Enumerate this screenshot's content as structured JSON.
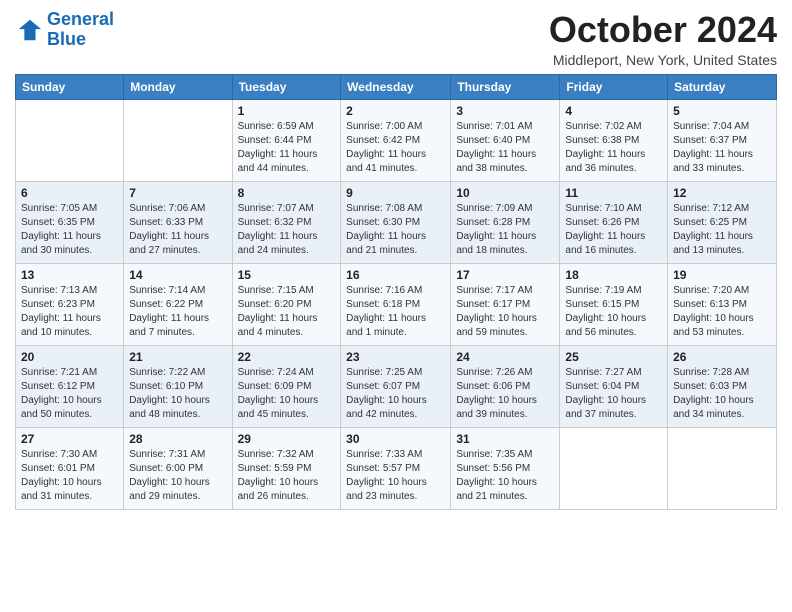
{
  "logo": {
    "line1": "General",
    "line2": "Blue"
  },
  "title": "October 2024",
  "subtitle": "Middleport, New York, United States",
  "days_of_week": [
    "Sunday",
    "Monday",
    "Tuesday",
    "Wednesday",
    "Thursday",
    "Friday",
    "Saturday"
  ],
  "weeks": [
    [
      {
        "day": "",
        "detail": ""
      },
      {
        "day": "",
        "detail": ""
      },
      {
        "day": "1",
        "detail": "Sunrise: 6:59 AM\nSunset: 6:44 PM\nDaylight: 11 hours and 44 minutes."
      },
      {
        "day": "2",
        "detail": "Sunrise: 7:00 AM\nSunset: 6:42 PM\nDaylight: 11 hours and 41 minutes."
      },
      {
        "day": "3",
        "detail": "Sunrise: 7:01 AM\nSunset: 6:40 PM\nDaylight: 11 hours and 38 minutes."
      },
      {
        "day": "4",
        "detail": "Sunrise: 7:02 AM\nSunset: 6:38 PM\nDaylight: 11 hours and 36 minutes."
      },
      {
        "day": "5",
        "detail": "Sunrise: 7:04 AM\nSunset: 6:37 PM\nDaylight: 11 hours and 33 minutes."
      }
    ],
    [
      {
        "day": "6",
        "detail": "Sunrise: 7:05 AM\nSunset: 6:35 PM\nDaylight: 11 hours and 30 minutes."
      },
      {
        "day": "7",
        "detail": "Sunrise: 7:06 AM\nSunset: 6:33 PM\nDaylight: 11 hours and 27 minutes."
      },
      {
        "day": "8",
        "detail": "Sunrise: 7:07 AM\nSunset: 6:32 PM\nDaylight: 11 hours and 24 minutes."
      },
      {
        "day": "9",
        "detail": "Sunrise: 7:08 AM\nSunset: 6:30 PM\nDaylight: 11 hours and 21 minutes."
      },
      {
        "day": "10",
        "detail": "Sunrise: 7:09 AM\nSunset: 6:28 PM\nDaylight: 11 hours and 18 minutes."
      },
      {
        "day": "11",
        "detail": "Sunrise: 7:10 AM\nSunset: 6:26 PM\nDaylight: 11 hours and 16 minutes."
      },
      {
        "day": "12",
        "detail": "Sunrise: 7:12 AM\nSunset: 6:25 PM\nDaylight: 11 hours and 13 minutes."
      }
    ],
    [
      {
        "day": "13",
        "detail": "Sunrise: 7:13 AM\nSunset: 6:23 PM\nDaylight: 11 hours and 10 minutes."
      },
      {
        "day": "14",
        "detail": "Sunrise: 7:14 AM\nSunset: 6:22 PM\nDaylight: 11 hours and 7 minutes."
      },
      {
        "day": "15",
        "detail": "Sunrise: 7:15 AM\nSunset: 6:20 PM\nDaylight: 11 hours and 4 minutes."
      },
      {
        "day": "16",
        "detail": "Sunrise: 7:16 AM\nSunset: 6:18 PM\nDaylight: 11 hours and 1 minute."
      },
      {
        "day": "17",
        "detail": "Sunrise: 7:17 AM\nSunset: 6:17 PM\nDaylight: 10 hours and 59 minutes."
      },
      {
        "day": "18",
        "detail": "Sunrise: 7:19 AM\nSunset: 6:15 PM\nDaylight: 10 hours and 56 minutes."
      },
      {
        "day": "19",
        "detail": "Sunrise: 7:20 AM\nSunset: 6:13 PM\nDaylight: 10 hours and 53 minutes."
      }
    ],
    [
      {
        "day": "20",
        "detail": "Sunrise: 7:21 AM\nSunset: 6:12 PM\nDaylight: 10 hours and 50 minutes."
      },
      {
        "day": "21",
        "detail": "Sunrise: 7:22 AM\nSunset: 6:10 PM\nDaylight: 10 hours and 48 minutes."
      },
      {
        "day": "22",
        "detail": "Sunrise: 7:24 AM\nSunset: 6:09 PM\nDaylight: 10 hours and 45 minutes."
      },
      {
        "day": "23",
        "detail": "Sunrise: 7:25 AM\nSunset: 6:07 PM\nDaylight: 10 hours and 42 minutes."
      },
      {
        "day": "24",
        "detail": "Sunrise: 7:26 AM\nSunset: 6:06 PM\nDaylight: 10 hours and 39 minutes."
      },
      {
        "day": "25",
        "detail": "Sunrise: 7:27 AM\nSunset: 6:04 PM\nDaylight: 10 hours and 37 minutes."
      },
      {
        "day": "26",
        "detail": "Sunrise: 7:28 AM\nSunset: 6:03 PM\nDaylight: 10 hours and 34 minutes."
      }
    ],
    [
      {
        "day": "27",
        "detail": "Sunrise: 7:30 AM\nSunset: 6:01 PM\nDaylight: 10 hours and 31 minutes."
      },
      {
        "day": "28",
        "detail": "Sunrise: 7:31 AM\nSunset: 6:00 PM\nDaylight: 10 hours and 29 minutes."
      },
      {
        "day": "29",
        "detail": "Sunrise: 7:32 AM\nSunset: 5:59 PM\nDaylight: 10 hours and 26 minutes."
      },
      {
        "day": "30",
        "detail": "Sunrise: 7:33 AM\nSunset: 5:57 PM\nDaylight: 10 hours and 23 minutes."
      },
      {
        "day": "31",
        "detail": "Sunrise: 7:35 AM\nSunset: 5:56 PM\nDaylight: 10 hours and 21 minutes."
      },
      {
        "day": "",
        "detail": ""
      },
      {
        "day": "",
        "detail": ""
      }
    ]
  ]
}
